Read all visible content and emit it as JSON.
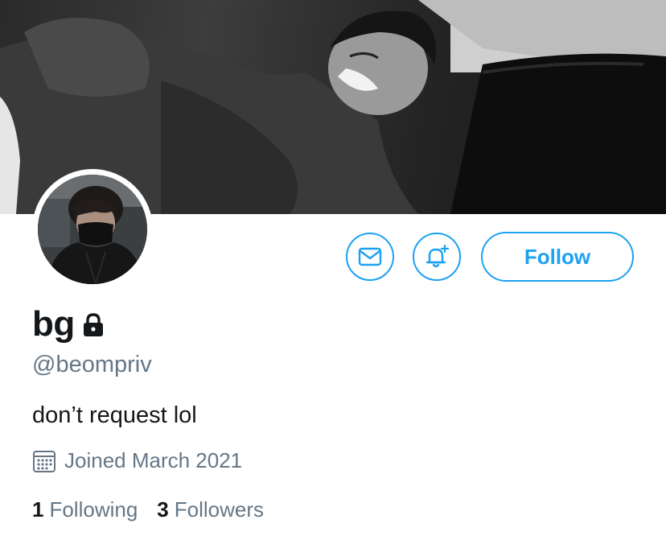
{
  "profile": {
    "display_name": "bg",
    "handle": "@beompriv",
    "bio": "don’t request lol",
    "joined": "Joined March 2021",
    "protected": true
  },
  "actions": {
    "message_icon": "envelope-icon",
    "notify_icon": "bell-plus-icon",
    "follow_label": "Follow"
  },
  "stats": {
    "following_count": "1",
    "following_label": "Following",
    "followers_count": "3",
    "followers_label": "Followers"
  },
  "colors": {
    "accent": "#1da1f2",
    "text_primary": "#14171a",
    "text_secondary": "#657786"
  }
}
